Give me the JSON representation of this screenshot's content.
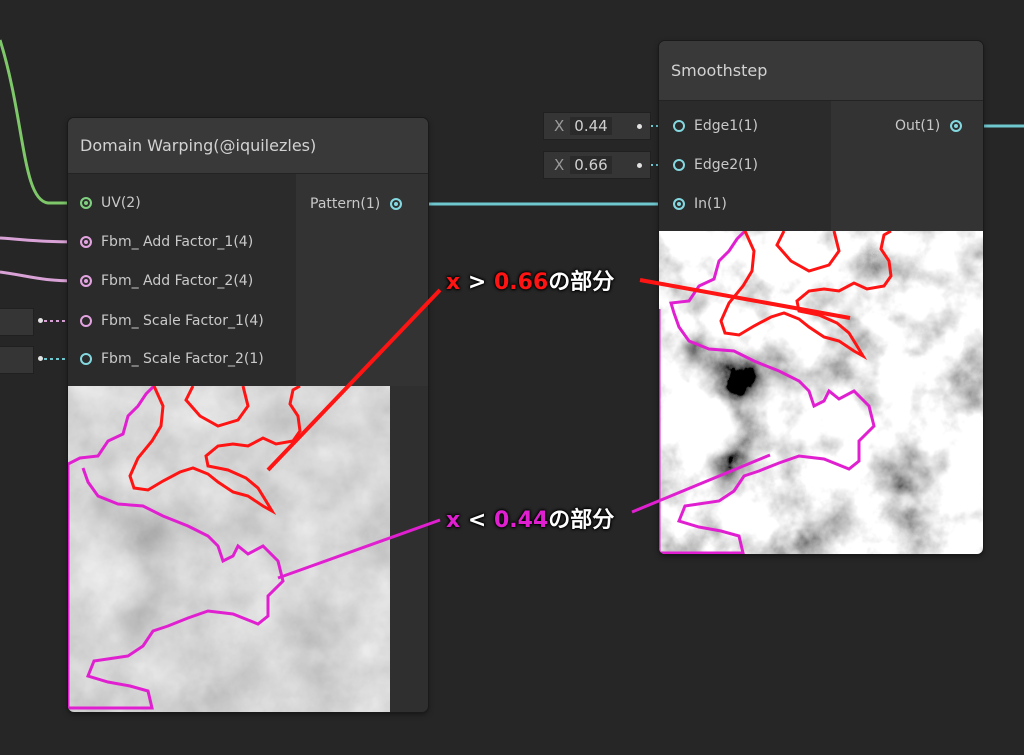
{
  "nodes": {
    "domain_warping": {
      "title": "Domain Warping(@iquilezles)",
      "inputs": [
        {
          "label": "UV(2)",
          "dot": "filled-green"
        },
        {
          "label": "Fbm_ Add Factor_1(4)",
          "dot": "filled-pink"
        },
        {
          "label": "Fbm_ Add Factor_2(4)",
          "dot": "filled-pink"
        },
        {
          "label": "Fbm_ Scale Factor_1(4)",
          "dot": "hollow-pink"
        },
        {
          "label": "Fbm_ Scale Factor_2(1)",
          "dot": "hollow-cyan"
        }
      ],
      "output": {
        "label": "Pattern(1)"
      }
    },
    "smoothstep": {
      "title": "Smoothstep",
      "inputs": [
        {
          "label": "Edge1(1)",
          "field_axis": "X",
          "field_value": "0.44"
        },
        {
          "label": "Edge2(1)",
          "field_axis": "X",
          "field_value": "0.66"
        },
        {
          "label": "In(1)"
        }
      ],
      "output": {
        "label": "Out(1)"
      }
    }
  },
  "annotations": {
    "high": {
      "prefix": "x",
      "symbol": ">",
      "value": "0.66",
      "suffix": "の部分",
      "color": "#ff1414"
    },
    "low": {
      "prefix": "x",
      "symbol": "<",
      "value": "0.44",
      "suffix": "の部分",
      "color": "#e020d0"
    }
  },
  "colors": {
    "uv_wire": "#7ec86a",
    "float_wire": "#6fc8cf",
    "vector4_wire": "#d9a2d6",
    "node_bg": "#2f2f2f",
    "title_bg": "#393939"
  }
}
